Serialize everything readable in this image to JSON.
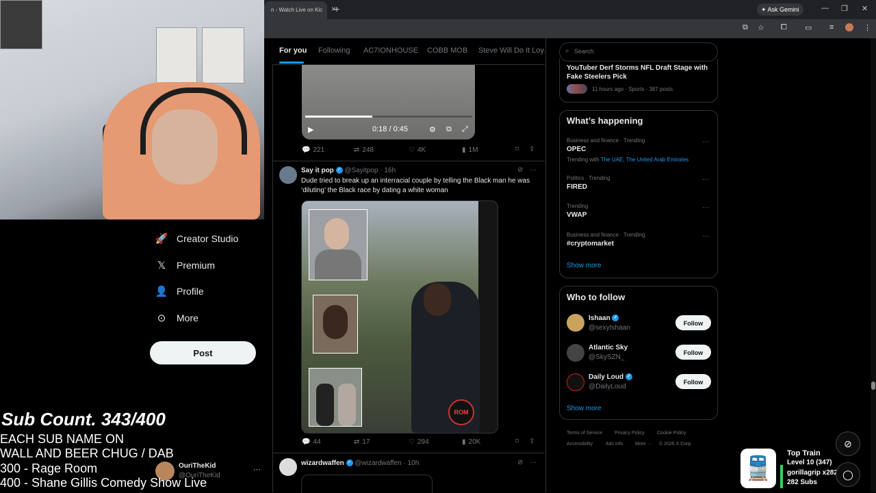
{
  "browser": {
    "tab_title": "n - Watch Live on Kic",
    "tab_close": "×",
    "new_tab": "+",
    "gemini_label": "Ask Gemini",
    "window_controls": [
      "—",
      "❐",
      "✕"
    ]
  },
  "sidebar": {
    "items": [
      {
        "label": "Creator Studio",
        "icon": "rocket-icon",
        "glyph": "🚀"
      },
      {
        "label": "Premium",
        "icon": "x-logo-icon",
        "glyph": "𝕏"
      },
      {
        "label": "Profile",
        "icon": "person-icon",
        "glyph": "👤"
      },
      {
        "label": "More",
        "icon": "more-circle-icon",
        "glyph": "⊙"
      }
    ],
    "post_button": "Post",
    "user": {
      "name": "OuriTheKid",
      "handle": "@OuriTheKid",
      "more": "···"
    }
  },
  "overlay": {
    "subcount": "Sub Count. 343/400",
    "lines": [
      "EACH SUB NAME ON",
      "WALL AND BEER CHUG / DAB",
      "300 - Rage Room",
      "400 - Shane Gillis Comedy Show Live"
    ]
  },
  "feed": {
    "tabs": [
      "For you",
      "Following",
      "AC7IONHOUSE",
      "COBB MOB",
      "Steve Will Do It Loyal"
    ],
    "video": {
      "time": "0:18 / 0:45",
      "progress": 0.4
    },
    "tweet1_actions": {
      "replies": "221",
      "reposts": "248",
      "likes": "4K",
      "views": "1M"
    },
    "tweet2": {
      "name": "Say it pop",
      "handle": "@Sayitpop",
      "time": "· 16h",
      "text": "Dude tried to break up an interracial couple by telling the Black man he was ‘diluting’ the Black race by dating a white woman",
      "actions": {
        "replies": "44",
        "reposts": "17",
        "likes": "294",
        "views": "20K"
      },
      "media_badge": "ROM"
    },
    "tweet3": {
      "name": "wizardwaffen",
      "handle": "@wizardwaffen",
      "time": "· 10h"
    }
  },
  "right": {
    "search_placeholder": "Search",
    "top_story": {
      "title": "YouTuber Derf Storms NFL Draft Stage with Fake Steelers Pick",
      "meta": "11 hours ago · Sports · 387 posts"
    },
    "whats_happening": {
      "heading": "What’s happening",
      "trends": [
        {
          "meta": "Business and finance · Trending",
          "title": "OPEC",
          "sub_prefix": "Trending with",
          "sub_links": "The UAE, The United Arab Emirates"
        },
        {
          "meta": "Politics · Trending",
          "title": "FIRED"
        },
        {
          "meta": "Trending",
          "title": "VWAP"
        },
        {
          "meta": "Business and finance · Trending",
          "title": "#cryptomarket"
        }
      ],
      "show_more": "Show more"
    },
    "who_to_follow": {
      "heading": "Who to follow",
      "users": [
        {
          "name": "Ishaan",
          "handle": "@sexyIshaan",
          "verified": true,
          "button": "Follow"
        },
        {
          "name": "Atlantic Sky",
          "handle": "@SkySZN_",
          "verified": false,
          "button": "Follow"
        },
        {
          "name": "Daily Loud",
          "handle": "@DailyLoud",
          "verified": true,
          "button": "Follow"
        }
      ],
      "show_more": "Show more"
    },
    "footer": [
      "Terms of Service",
      "Privacy Policy",
      "Cookie Policy",
      "Accessibility",
      "Ads info",
      "More ···",
      "© 2026 X Corp."
    ]
  },
  "train": {
    "title": "Top Train",
    "level": "Level 10  (347)",
    "user": "gorillagrip x282",
    "subs": "282 Subs"
  }
}
